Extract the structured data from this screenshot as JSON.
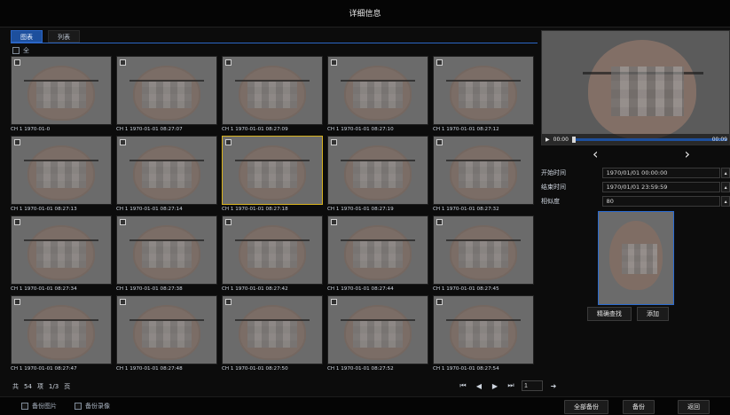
{
  "window": {
    "title": "详细信息"
  },
  "tabs": [
    {
      "label": "图表",
      "active": true
    },
    {
      "label": "列表",
      "active": false
    }
  ],
  "select_all": {
    "label": "全"
  },
  "thumbnails": [
    {
      "caption": "CH 1 1970-01-0",
      "selected": false
    },
    {
      "caption": "CH 1 1970-01-01 08:27:07",
      "selected": false
    },
    {
      "caption": "CH 1 1970-01-01 08:27:09",
      "selected": false
    },
    {
      "caption": "CH 1 1970-01-01 08:27:10",
      "selected": false
    },
    {
      "caption": "CH 1 1970-01-01 08:27:12",
      "selected": false
    },
    {
      "caption": "CH 1 1970-01-01 08:27:13",
      "selected": false
    },
    {
      "caption": "CH 1 1970-01-01 08:27:14",
      "selected": false
    },
    {
      "caption": "CH 1 1970-01-01 08:27:18",
      "selected": true
    },
    {
      "caption": "CH 1 1970-01-01 08:27:19",
      "selected": false
    },
    {
      "caption": "CH 1 1970-01-01 08:27:32",
      "selected": false
    },
    {
      "caption": "CH 1 1970-01-01 08:27:34",
      "selected": false
    },
    {
      "caption": "CH 1 1970-01-01 08:27:38",
      "selected": false
    },
    {
      "caption": "CH 1 1970-01-01 08:27:42",
      "selected": false
    },
    {
      "caption": "CH 1 1970-01-01 08:27:44",
      "selected": false
    },
    {
      "caption": "CH 1 1970-01-01 08:27:45",
      "selected": false
    },
    {
      "caption": "CH 1 1970-01-01 08:27:47",
      "selected": false
    },
    {
      "caption": "CH 1 1970-01-01 08:27:48",
      "selected": false
    },
    {
      "caption": "CH 1 1970-01-01 08:27:50",
      "selected": false
    },
    {
      "caption": "CH 1 1970-01-01 08:27:52",
      "selected": false
    },
    {
      "caption": "CH 1 1970-01-01 08:27:54",
      "selected": false
    }
  ],
  "list_summary": {
    "prefix": "共",
    "count": "54",
    "unit": "项",
    "page": "1/3",
    "page_unit": "页"
  },
  "pager": {
    "first_icon": "first-page-icon",
    "prev_icon": "prev-page-icon",
    "next_icon": "next-page-icon",
    "last_icon": "last-page-icon",
    "page_value": "1",
    "go_icon": "go-arrow-icon"
  },
  "player": {
    "time_start": "00:00",
    "time_end": "00:09"
  },
  "filters": {
    "start_time_label": "开始时间",
    "start_time_value": "1970/01/01 00:00:00",
    "end_time_label": "结束时间",
    "end_time_value": "1970/01/01 23:59:59",
    "similarity_label": "相似度",
    "similarity_value": "80"
  },
  "right_actions": {
    "search_label": "精确查找",
    "add_label": "添加"
  },
  "bottom_options": {
    "backup_image_label": "备份图片",
    "backup_video_label": "备份录像"
  },
  "bottom_actions": {
    "backup_all_label": "全部备份",
    "backup_label": "备份",
    "back_label": "返回"
  },
  "colors": {
    "accent": "#1d4f9d",
    "selected": "#d8b21e"
  }
}
